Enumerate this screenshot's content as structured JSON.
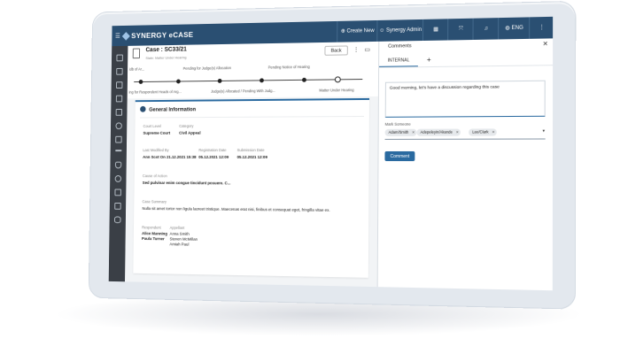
{
  "app": {
    "logo": "SYNERGY eCASE"
  },
  "topbar": {
    "create_label": "Create New",
    "user_label": "Synergy Admin",
    "lang_label": "ENG"
  },
  "case": {
    "title": "Case : SC33/21",
    "subtitle": "State: Matter Under Hearing",
    "back_label": "Back"
  },
  "stepper": {
    "top_labels": [
      "idb of Ar...",
      "Pending for Judge(s) Allocation",
      "Pending Notice of Hearing"
    ],
    "bottom_labels": [
      "ing for Respondent Heads of Arg...",
      "Judge(s) Allocated / Pending With Judg...",
      "Matter Under Hearing"
    ],
    "current_index": 5
  },
  "general": {
    "heading": "General Information",
    "court_level_label": "Court Level",
    "court_level": "Supreme Court",
    "category_label": "Category",
    "category": "Civil Appeal",
    "modified_label": "Last Modified By",
    "modified": "Ann Scot On 21.12.2021 15:38",
    "registration_label": "Registration Date",
    "registration": "05.12.2021 12:09",
    "submission_label": "Submission Date",
    "submission": "05.12.2021 12:09",
    "cause_label": "Cause of Action",
    "cause": "Sed pulvinar enim congue tincidunt posuere. C...",
    "summary_label": "Case Summary",
    "summary": "Nulla sit amet tortor non ligula laoreet tristique. Maecenas erat nisi, finibus et consequat eget, fringilla vitae ex.",
    "respondent_label": "Respondent",
    "respondents": [
      "Alice Manning",
      "Paula Turner"
    ],
    "appellant_label": "Appellant",
    "appellants": [
      "Anna Smith",
      "Steven McMillan",
      "Amiah Paul"
    ]
  },
  "comments": {
    "title": "Comments",
    "tab": "INTERNAL",
    "add_tab": "+",
    "message": "Good morning, let's have a discussion regarding this case",
    "mark_label": "Mark Someone",
    "chips": [
      "Adam/Smith",
      "Adepeleyin/Akande",
      "Lee/Clark"
    ],
    "button": "Comment"
  },
  "colors": {
    "topbar": "#2a4f72",
    "sidebar": "#3a3f46",
    "accent": "#2a6aa0"
  }
}
